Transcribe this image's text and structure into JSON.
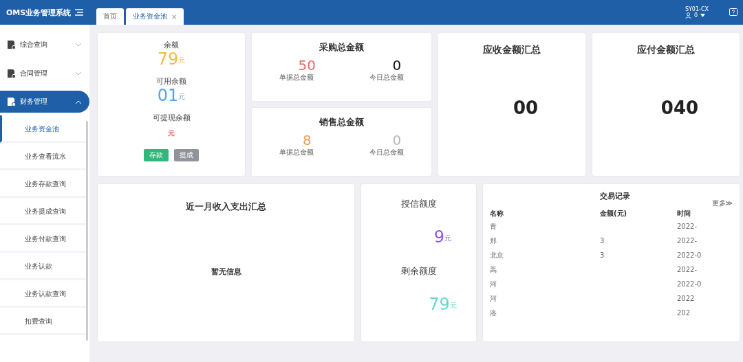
{
  "header": {
    "title": "OMS业务管理系统",
    "user_code": "SY01-CX",
    "user_name": "0"
  },
  "tabs": [
    {
      "label": "首页",
      "selected": false
    },
    {
      "label": "业务资金池",
      "selected": true,
      "close": "×"
    }
  ],
  "sidebar": {
    "groups": [
      {
        "label": "综合查询",
        "expanded": false,
        "selected": false
      },
      {
        "label": "合同管理",
        "expanded": false,
        "selected": false
      },
      {
        "label": "财务管理",
        "expanded": true,
        "selected": true,
        "children": [
          {
            "label": "业务资金池",
            "selected": true
          },
          {
            "label": "业务查看流水",
            "selected": false
          },
          {
            "label": "业务存款查询",
            "selected": false
          },
          {
            "label": "业务提成查询",
            "selected": false
          },
          {
            "label": "业务付款查询",
            "selected": false
          },
          {
            "label": "业务认款",
            "selected": false
          },
          {
            "label": "业务认款查询",
            "selected": false
          },
          {
            "label": "扣费查询",
            "selected": false
          }
        ]
      }
    ]
  },
  "balance": {
    "items": [
      {
        "label": "余额",
        "value": "79",
        "unit": "元",
        "color": "#f0b94a"
      },
      {
        "label": "可用余额",
        "value": "01",
        "unit": "元",
        "color": "#5aa1e8"
      },
      {
        "label": "可提现余额",
        "unit": "元",
        "color": "#e56b6b"
      }
    ],
    "buttons": [
      {
        "label": "存款",
        "kind": "primary"
      },
      {
        "label": "提成",
        "kind": "secondary"
      }
    ]
  },
  "purchase": {
    "title": "采购总金额",
    "stats": [
      {
        "value": "50",
        "label": "单据总金额",
        "color": "#e86a6a"
      },
      {
        "value": "0",
        "label": "今日总金额",
        "color": "#111111"
      }
    ]
  },
  "sales": {
    "title": "销售总金额",
    "stats": [
      {
        "value": "8",
        "label": "单据总金额",
        "color": "#e8a04a"
      },
      {
        "value": "0",
        "label": "今日总金额",
        "color": "#b8b8c4"
      }
    ]
  },
  "receivable": {
    "title": "应收金额汇总",
    "value": "00"
  },
  "payable": {
    "title": "应付金额汇总",
    "value": "040"
  },
  "income_summary": {
    "title": "近一月收入支出汇总",
    "empty_text": "暂无信息"
  },
  "credit": {
    "items": [
      {
        "label": "授信额度",
        "value": "9",
        "unit": "元",
        "color": "#8b5be0"
      },
      {
        "label": "剩余额度",
        "value": "79",
        "unit": "元",
        "color": "#5fdcc8"
      }
    ]
  },
  "transactions": {
    "title": "交易记录",
    "more": "更多≫",
    "columns": [
      "名称",
      "金额(元)",
      "时间"
    ],
    "rows": [
      {
        "name": "青",
        "time": "2022-"
      },
      {
        "name": "郑",
        "amount": "3",
        "time": "2022-"
      },
      {
        "name": "北京",
        "amount": "3",
        "time": "2022-0"
      },
      {
        "name": "禹",
        "time": "2022-"
      },
      {
        "name": "河",
        "time": "2022-0"
      },
      {
        "name": "河",
        "time": "2022"
      },
      {
        "name": "洛",
        "time": "202"
      }
    ]
  }
}
